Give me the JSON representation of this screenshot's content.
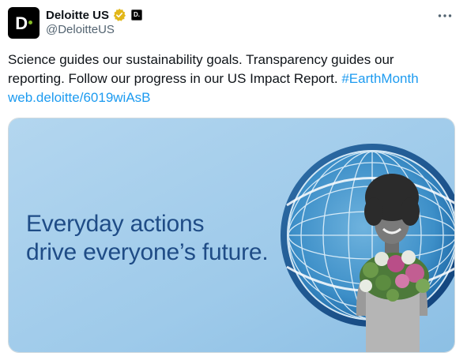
{
  "account": {
    "display_name": "Deloitte US",
    "handle": "@DeloitteUS",
    "avatar_letter": "D",
    "affiliate_letter": "D."
  },
  "tweet": {
    "text_part1": "Science guides our sustainability goals. Transparency guides our reporting. Follow our progress in our US Impact Report. ",
    "hashtag": "#EarthMonth",
    "link": "web.deloitte/6019wiAsB"
  },
  "media": {
    "headline_line1": "Everyday actions",
    "headline_line2": "drive everyone’s future."
  },
  "colors": {
    "brand_green": "#86bc25",
    "link_blue": "#1d9bf0",
    "headline_blue": "#1f4c86",
    "verified_gold": "#e2b719"
  }
}
